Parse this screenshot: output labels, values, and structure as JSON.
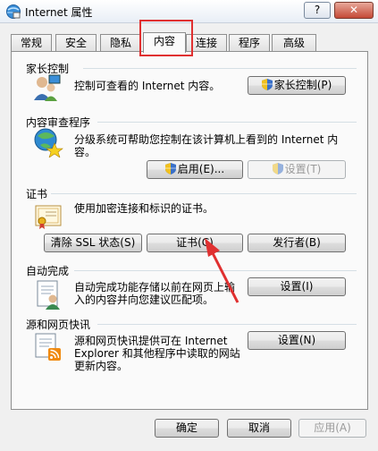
{
  "window": {
    "title": "Internet 属性",
    "help_label": "?",
    "close_label": "✕"
  },
  "tabs": [
    {
      "label": "常规"
    },
    {
      "label": "安全"
    },
    {
      "label": "隐私"
    },
    {
      "label": "内容",
      "active": true
    },
    {
      "label": "连接"
    },
    {
      "label": "程序"
    },
    {
      "label": "高级"
    }
  ],
  "sections": {
    "parental": {
      "title": "家长控制",
      "text": "控制可查看的 Internet 内容。",
      "button": "家长控制(P)"
    },
    "advisor": {
      "title": "内容审查程序",
      "text_line1": "分级系统可帮助您控制在该计算机上看到的 Internet 内",
      "text_line2": "容。",
      "enable_button": "启用(E)...",
      "settings_button": "设置(T)"
    },
    "certificates": {
      "title": "证书",
      "text": "使用加密连接和标识的证书。",
      "clear_ssl_button": "清除 SSL 状态(S)",
      "certs_button": "证书(C)",
      "publishers_button": "发行者(B)"
    },
    "autocomplete": {
      "title": "自动完成",
      "text_line1": "自动完成功能存储以前在网页上输",
      "text_line2": "入的内容并向您建议匹配项。",
      "button": "设置(I)"
    },
    "feeds": {
      "title": "源和网页快讯",
      "text_line1": "源和网页快讯提供可在 Internet",
      "text_line2": "Explorer 和其他程序中读取的网站",
      "text_line3": "更新内容。",
      "button": "设置(N)"
    }
  },
  "footer": {
    "ok": "确定",
    "cancel": "取消",
    "apply": "应用(A)"
  },
  "colors": {
    "highlight": "#e03030",
    "arrow": "#e03030"
  }
}
